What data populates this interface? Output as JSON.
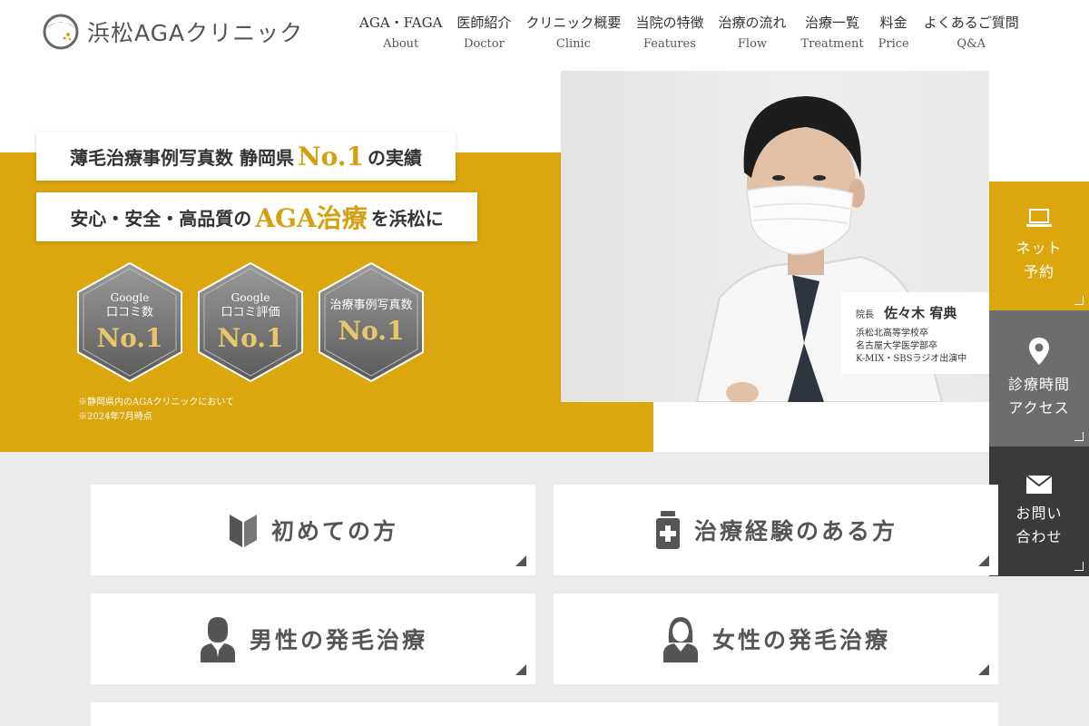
{
  "header": {
    "logo_text": "浜松AGAクリニック",
    "nav": [
      {
        "jp": "AGA・FAGA",
        "en": "About"
      },
      {
        "jp": "医師紹介",
        "en": "Doctor"
      },
      {
        "jp": "クリニック概要",
        "en": "Clinic"
      },
      {
        "jp": "当院の特徴",
        "en": "Features"
      },
      {
        "jp": "治療の流れ",
        "en": "Flow"
      },
      {
        "jp": "治療一覧",
        "en": "Treatment"
      },
      {
        "jp": "料金",
        "en": "Price"
      },
      {
        "jp": "よくあるご質問",
        "en": "Q&A"
      }
    ]
  },
  "hero": {
    "banner1": {
      "pre": "薄毛治療事例写真数 静岡県",
      "hl": "No.1",
      "post": "の実績"
    },
    "banner2": {
      "pre": "安心・安全・高品質の",
      "hl": "AGA治療",
      "post": "を浜松に"
    },
    "badges": [
      {
        "line1": "Google",
        "line2": "口コミ数",
        "no": "No.1"
      },
      {
        "line1": "Google",
        "line2": "口コミ評価",
        "no": "No.1"
      },
      {
        "line1": "",
        "line2": "治療事例写真数",
        "no": "No.1"
      }
    ],
    "notes": [
      "※静岡県内のAGAクリニックにおいて",
      "※2024年7月時点"
    ]
  },
  "doctor": {
    "title": "院長",
    "name": "佐々木 宥典",
    "lines": [
      "浜松北高等学校卒",
      "名古屋大学医学部卒",
      "K-MIX・SBSラジオ出演中"
    ]
  },
  "side": [
    {
      "label": "ネット\n予約",
      "icon": "laptop-icon"
    },
    {
      "label": "診療時間\nアクセス",
      "icon": "map-pin-icon"
    },
    {
      "label": "お問い\n合わせ",
      "icon": "mail-icon"
    }
  ],
  "cards": [
    {
      "label": "初めての方",
      "icon": "beginner-mark-icon"
    },
    {
      "label": "治療経験のある方",
      "icon": "medicine-bottle-icon"
    },
    {
      "label": "男性の発毛治療",
      "icon": "man-icon"
    },
    {
      "label": "女性の発毛治療",
      "icon": "woman-icon"
    }
  ],
  "colors": {
    "accent": "#dca60f",
    "grey": "#6d6d6d",
    "dark": "#3a3a3a"
  }
}
